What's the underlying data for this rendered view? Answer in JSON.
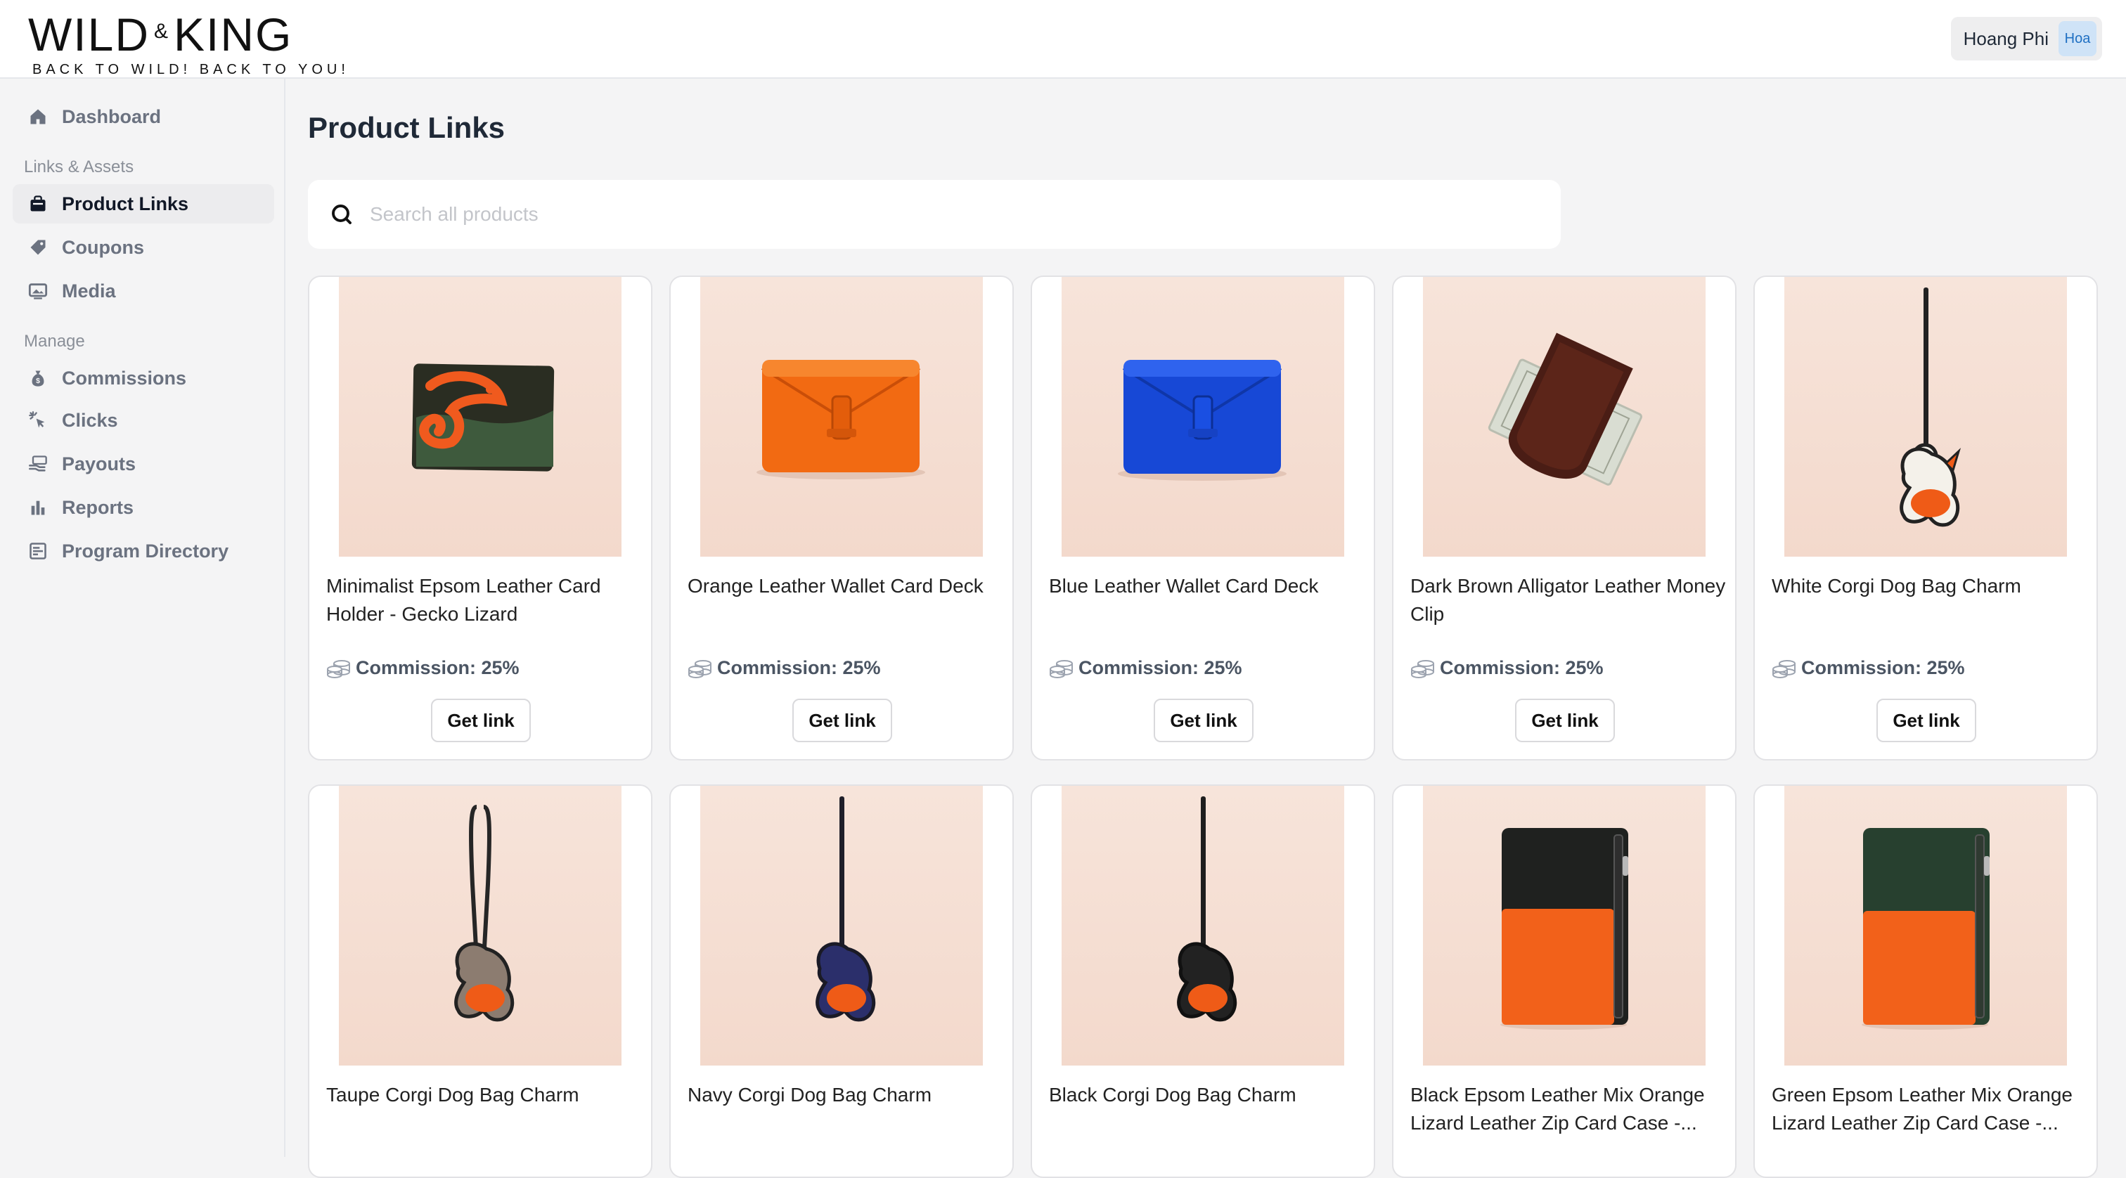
{
  "brand": {
    "name_left": "WILD",
    "name_amp": "&",
    "name_right": "KING",
    "tagline": "BACK TO WILD! BACK TO YOU!"
  },
  "user": {
    "name": "Hoang Phi",
    "avatar_text": "Hoa"
  },
  "sidebar": {
    "dashboard": "Dashboard",
    "section_links": "Links & Assets",
    "product_links": "Product Links",
    "coupons": "Coupons",
    "media": "Media",
    "section_manage": "Manage",
    "commissions": "Commissions",
    "clicks": "Clicks",
    "payouts": "Payouts",
    "reports": "Reports",
    "program_directory": "Program Directory"
  },
  "main": {
    "title": "Product Links",
    "search_placeholder": "Search all products"
  },
  "products": [
    {
      "title": "Minimalist Epsom Leather Card Holder - Gecko Lizard",
      "commission": "Commission: 25%",
      "button": "Get link",
      "image": "gecko-card-holder"
    },
    {
      "title": "Orange Leather Wallet Card Deck",
      "commission": "Commission: 25%",
      "button": "Get link",
      "image": "orange-wallet"
    },
    {
      "title": "Blue Leather Wallet Card Deck",
      "commission": "Commission: 25%",
      "button": "Get link",
      "image": "blue-wallet"
    },
    {
      "title": "Dark Brown Alligator Leather Money Clip",
      "commission": "Commission: 25%",
      "button": "Get link",
      "image": "money-clip"
    },
    {
      "title": "White Corgi Dog Bag Charm",
      "commission": "Commission: 25%",
      "button": "Get link",
      "image": "white-corgi-charm"
    },
    {
      "title": "Taupe Corgi Dog Bag Charm",
      "image": "taupe-corgi-charm"
    },
    {
      "title": "Navy Corgi Dog Bag Charm",
      "image": "navy-corgi-charm"
    },
    {
      "title": "Black Corgi Dog Bag Charm",
      "image": "black-corgi-charm"
    },
    {
      "title": "Black Epsom Leather Mix Orange Lizard Leather Zip Card Case -...",
      "image": "black-zip-card-case"
    },
    {
      "title": "Green Epsom Leather Mix Orange Lizard Leather Zip Card Case -...",
      "image": "green-zip-card-case"
    }
  ],
  "colors": {
    "background": "#f4f4f5",
    "panel": "#ffffff",
    "avatar_bg": "#cfe3f7",
    "avatar_text": "#1e6fc2"
  }
}
